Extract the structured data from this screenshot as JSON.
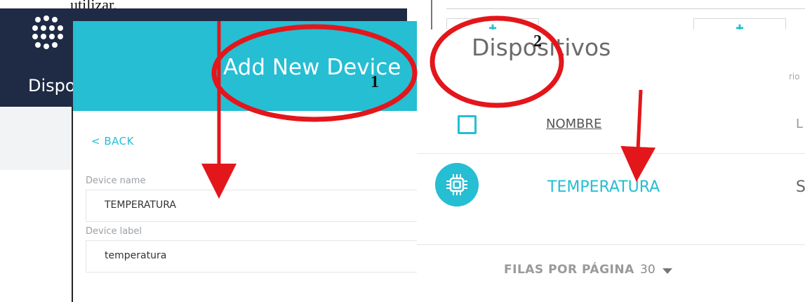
{
  "caption_top": "utilizar.",
  "left_app": {
    "nav_label": "Dispo",
    "panel_title": "Add New Device",
    "back_link": "< BACK",
    "fields": [
      {
        "label": "Device name",
        "value": "TEMPERATURA"
      },
      {
        "label": "Device label",
        "value": "temperatura"
      }
    ]
  },
  "right_app": {
    "title": "Dispositivos",
    "column_header": "NOMBRE",
    "next_column_header_glimpse": "L",
    "row_device_name": "TEMPERATURA",
    "row_glimpse": "S",
    "rows_per_page_label": "FILAS POR PÁGINA",
    "rows_per_page_value": "30",
    "side_glimpse_text": "rio"
  },
  "annotations": {
    "label_1": "1",
    "label_2": "2",
    "color": "#e3161b"
  },
  "colors": {
    "accent": "#25bed3",
    "dark_header": "#1f2a44"
  },
  "icons": {
    "logo": "dot-grid-logo-icon",
    "device": "chip-icon",
    "rows_dropdown": "caret-down-icon"
  }
}
